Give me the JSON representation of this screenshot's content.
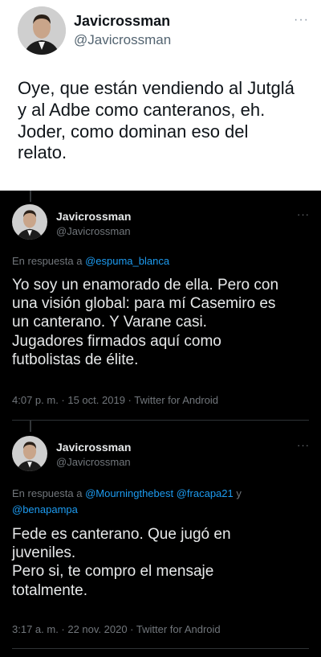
{
  "main_tweet": {
    "display_name": "Javicrossman",
    "handle": "@Javicrossman",
    "more": "···",
    "text_lines": [
      "Oye, que están vendiendo al Jutglá",
      "y al Adbe como canteranos, eh.",
      "Joder, como dominan eso del",
      "relato."
    ]
  },
  "tweets": [
    {
      "display_name": "Javicrossman",
      "handle": "@Javicrossman",
      "more": "···",
      "reply_prefix": "En respuesta a ",
      "reply_mentions": [
        "@espuma_blanca"
      ],
      "text_lines": [
        "Yo soy un enamorado de ella. Pero con",
        "una visión global: para mí Casemiro es",
        "un canterano. Y Varane casi.",
        "Jugadores firmados aquí como",
        "futbolistas de élite."
      ],
      "timestamp": "4:07 p. m. · 15 oct. 2019 · Twitter for Android"
    },
    {
      "display_name": "Javicrossman",
      "handle": "@Javicrossman",
      "more": "···",
      "reply_prefix": "En respuesta a ",
      "reply_mentions": [
        "@Mourningthebest",
        "@fracapa21",
        "@benapampa"
      ],
      "reply_joiner": " y",
      "text_lines": [
        "Fede es canterano. Que jugó en",
        "juveniles.",
        "Pero si, te compro el mensaje",
        "totalmente."
      ],
      "timestamp": "3:17 a. m. · 22 nov. 2020 · Twitter for Android"
    }
  ]
}
